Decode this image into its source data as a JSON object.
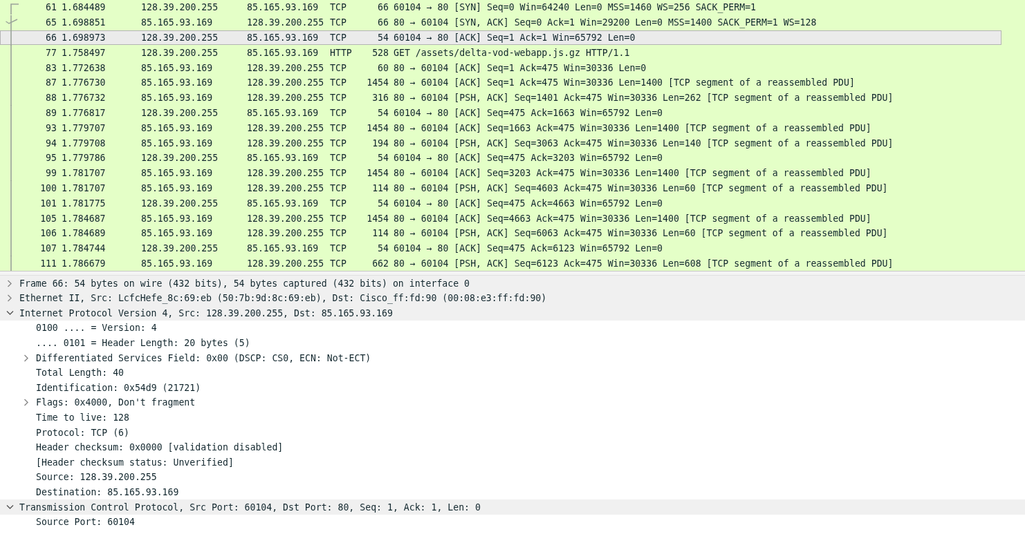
{
  "packet_list": {
    "rows": [
      {
        "no": "61",
        "time": "1.684489",
        "source": "128.39.200.255",
        "destination": "85.165.93.169",
        "protocol": "TCP",
        "length": "66",
        "info": "60104 → 80 [SYN] Seq=0 Win=64240 Len=0 MSS=1460 WS=256 SACK_PERM=1",
        "kind": "start",
        "selected": false
      },
      {
        "no": "65",
        "time": "1.698851",
        "source": "85.165.93.169",
        "destination": "128.39.200.255",
        "protocol": "TCP",
        "length": "66",
        "info": "80 → 60104 [SYN, ACK] Seq=0 Ack=1 Win=29200 Len=0 MSS=1400 SACK_PERM=1 WS=128",
        "kind": "response",
        "selected": false
      },
      {
        "no": "66",
        "time": "1.698973",
        "source": "128.39.200.255",
        "destination": "85.165.93.169",
        "protocol": "TCP",
        "length": "54",
        "info": "60104 → 80 [ACK] Seq=1 Ack=1 Win=65792 Len=0",
        "kind": "line",
        "selected": true
      },
      {
        "no": "77",
        "time": "1.758497",
        "source": "128.39.200.255",
        "destination": "85.165.93.169",
        "protocol": "HTTP",
        "length": "528",
        "info": "GET /assets/delta-vod-webapp.js.gz HTTP/1.1",
        "kind": "line",
        "selected": false
      },
      {
        "no": "83",
        "time": "1.772638",
        "source": "85.165.93.169",
        "destination": "128.39.200.255",
        "protocol": "TCP",
        "length": "60",
        "info": "80 → 60104 [ACK] Seq=1 Ack=475 Win=30336 Len=0",
        "kind": "line",
        "selected": false
      },
      {
        "no": "87",
        "time": "1.776730",
        "source": "85.165.93.169",
        "destination": "128.39.200.255",
        "protocol": "TCP",
        "length": "1454",
        "info": "80 → 60104 [ACK] Seq=1 Ack=475 Win=30336 Len=1400 [TCP segment of a reassembled PDU]",
        "kind": "line",
        "selected": false
      },
      {
        "no": "88",
        "time": "1.776732",
        "source": "85.165.93.169",
        "destination": "128.39.200.255",
        "protocol": "TCP",
        "length": "316",
        "info": "80 → 60104 [PSH, ACK] Seq=1401 Ack=475 Win=30336 Len=262 [TCP segment of a reassembled PDU]",
        "kind": "line",
        "selected": false
      },
      {
        "no": "89",
        "time": "1.776817",
        "source": "128.39.200.255",
        "destination": "85.165.93.169",
        "protocol": "TCP",
        "length": "54",
        "info": "60104 → 80 [ACK] Seq=475 Ack=1663 Win=65792 Len=0",
        "kind": "line",
        "selected": false
      },
      {
        "no": "93",
        "time": "1.779707",
        "source": "85.165.93.169",
        "destination": "128.39.200.255",
        "protocol": "TCP",
        "length": "1454",
        "info": "80 → 60104 [ACK] Seq=1663 Ack=475 Win=30336 Len=1400 [TCP segment of a reassembled PDU]",
        "kind": "line",
        "selected": false
      },
      {
        "no": "94",
        "time": "1.779708",
        "source": "85.165.93.169",
        "destination": "128.39.200.255",
        "protocol": "TCP",
        "length": "194",
        "info": "80 → 60104 [PSH, ACK] Seq=3063 Ack=475 Win=30336 Len=140 [TCP segment of a reassembled PDU]",
        "kind": "line",
        "selected": false
      },
      {
        "no": "95",
        "time": "1.779786",
        "source": "128.39.200.255",
        "destination": "85.165.93.169",
        "protocol": "TCP",
        "length": "54",
        "info": "60104 → 80 [ACK] Seq=475 Ack=3203 Win=65792 Len=0",
        "kind": "line",
        "selected": false
      },
      {
        "no": "99",
        "time": "1.781707",
        "source": "85.165.93.169",
        "destination": "128.39.200.255",
        "protocol": "TCP",
        "length": "1454",
        "info": "80 → 60104 [ACK] Seq=3203 Ack=475 Win=30336 Len=1400 [TCP segment of a reassembled PDU]",
        "kind": "line",
        "selected": false
      },
      {
        "no": "100",
        "time": "1.781707",
        "source": "85.165.93.169",
        "destination": "128.39.200.255",
        "protocol": "TCP",
        "length": "114",
        "info": "80 → 60104 [PSH, ACK] Seq=4603 Ack=475 Win=30336 Len=60 [TCP segment of a reassembled PDU]",
        "kind": "line",
        "selected": false
      },
      {
        "no": "101",
        "time": "1.781775",
        "source": "128.39.200.255",
        "destination": "85.165.93.169",
        "protocol": "TCP",
        "length": "54",
        "info": "60104 → 80 [ACK] Seq=475 Ack=4663 Win=65792 Len=0",
        "kind": "line",
        "selected": false
      },
      {
        "no": "105",
        "time": "1.784687",
        "source": "85.165.93.169",
        "destination": "128.39.200.255",
        "protocol": "TCP",
        "length": "1454",
        "info": "80 → 60104 [ACK] Seq=4663 Ack=475 Win=30336 Len=1400 [TCP segment of a reassembled PDU]",
        "kind": "line",
        "selected": false
      },
      {
        "no": "106",
        "time": "1.784689",
        "source": "85.165.93.169",
        "destination": "128.39.200.255",
        "protocol": "TCP",
        "length": "114",
        "info": "80 → 60104 [PSH, ACK] Seq=6063 Ack=475 Win=30336 Len=60 [TCP segment of a reassembled PDU]",
        "kind": "line",
        "selected": false
      },
      {
        "no": "107",
        "time": "1.784744",
        "source": "128.39.200.255",
        "destination": "85.165.93.169",
        "protocol": "TCP",
        "length": "54",
        "info": "60104 → 80 [ACK] Seq=475 Ack=6123 Win=65792 Len=0",
        "kind": "line",
        "selected": false
      },
      {
        "no": "111",
        "time": "1.786679",
        "source": "85.165.93.169",
        "destination": "128.39.200.255",
        "protocol": "TCP",
        "length": "662",
        "info": "80 → 60104 [PSH, ACK] Seq=6123 Ack=475 Win=30336 Len=608 [TCP segment of a reassembled PDU]",
        "kind": "line",
        "selected": false
      }
    ]
  },
  "packet_details": {
    "items": [
      {
        "text": "Frame 66: 54 bytes on wire (432 bits), 54 bytes captured (432 bits) on interface 0",
        "expanded": false
      },
      {
        "text": "Ethernet II, Src: LcfcHefe_8c:69:eb (50:7b:9d:8c:69:eb), Dst: Cisco_ff:fd:90 (00:08:e3:ff:fd:90)",
        "expanded": false
      },
      {
        "text": "Internet Protocol Version 4, Src: 128.39.200.255, Dst: 85.165.93.169",
        "expanded": true,
        "children": [
          {
            "text": "0100 .... = Version: 4"
          },
          {
            "text": ".... 0101 = Header Length: 20 bytes (5)"
          },
          {
            "text": "Differentiated Services Field: 0x00 (DSCP: CS0, ECN: Not-ECT)",
            "expanded": false
          },
          {
            "text": "Total Length: 40"
          },
          {
            "text": "Identification: 0x54d9 (21721)"
          },
          {
            "text": "Flags: 0x4000, Don't fragment",
            "expanded": false
          },
          {
            "text": "Time to live: 128"
          },
          {
            "text": "Protocol: TCP (6)"
          },
          {
            "text": "Header checksum: 0x0000 [validation disabled]"
          },
          {
            "text": "[Header checksum status: Unverified]"
          },
          {
            "text": "Source: 128.39.200.255"
          },
          {
            "text": "Destination: 85.165.93.169"
          }
        ]
      },
      {
        "text": "Transmission Control Protocol, Src Port: 60104, Dst Port: 80, Seq: 1, Ack: 1, Len: 0",
        "expanded": true,
        "children": [
          {
            "text": "Source Port: 60104"
          }
        ]
      }
    ]
  }
}
